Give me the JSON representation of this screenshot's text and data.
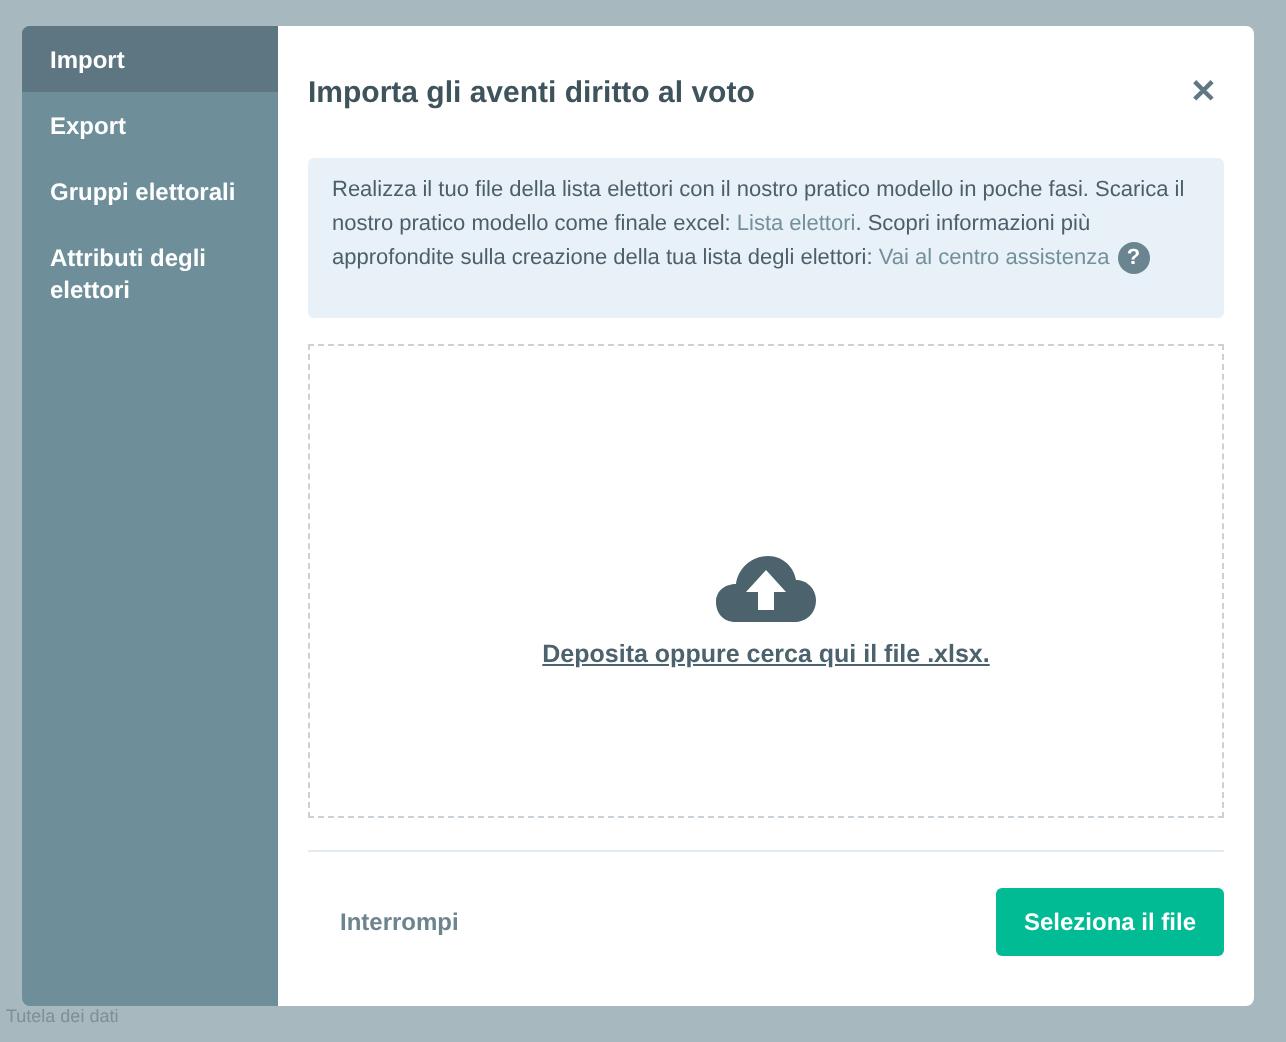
{
  "background_page": {
    "footer_link": "Tutela dei dati"
  },
  "sidebar": {
    "items": [
      {
        "label": "Import",
        "selected": true
      },
      {
        "label": "Export",
        "selected": false
      },
      {
        "label": "Gruppi elettorali",
        "selected": false
      },
      {
        "label": "Attributi degli elettori",
        "selected": false
      }
    ]
  },
  "dialog": {
    "title": "Importa gli aventi diritto al voto",
    "close": "✕",
    "info": [
      {
        "kind": "text",
        "text": "Realizza il tuo file della lista elettori con il nostro pratico modello in poche fasi. Scarica il nostro pratico modello come finale excel: "
      },
      {
        "kind": "link",
        "text": "Lista elettori"
      },
      {
        "kind": "text",
        "text": ". Scopri informazioni più approfondite sulla creazione della tua lista degli elettori: "
      },
      {
        "kind": "link",
        "text": "Vai al centro assistenza"
      },
      {
        "kind": "help",
        "text": "?"
      }
    ],
    "dropzone": {
      "label": "Deposita oppure cerca qui il file .xlsx."
    },
    "buttons": [
      {
        "kind": "secondary",
        "label": "Interrompi"
      },
      {
        "kind": "primary",
        "label": "Seleziona il file"
      }
    ]
  }
}
